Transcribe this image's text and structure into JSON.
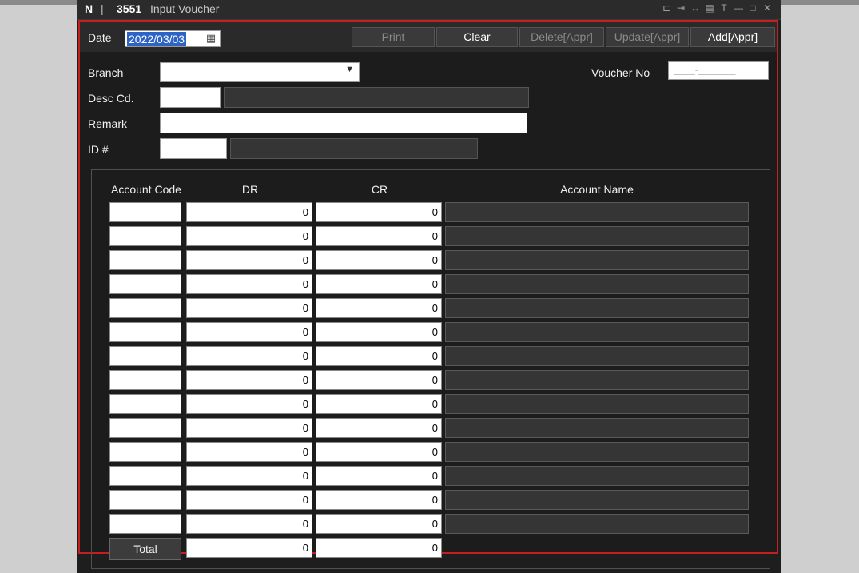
{
  "window": {
    "prefix": "N",
    "separator": "|",
    "screen_code": "3551",
    "screen_name": "Input Voucher",
    "icons": [
      "pin-icon",
      "export-icon",
      "link-icon",
      "copy-icon",
      "text-icon",
      "minimize-icon",
      "maximize-icon",
      "close-icon"
    ]
  },
  "toolbar": {
    "date_label": "Date",
    "date_value": "2022/03/03",
    "print_label": "Print",
    "clear_label": "Clear",
    "delete_label": "Delete[Appr]",
    "update_label": "Update[Appr]",
    "add_label": "Add[Appr]"
  },
  "form": {
    "branch_label": "Branch",
    "branch_value": "",
    "voucher_no_label": "Voucher No",
    "voucher_no_value": "____-_______",
    "desc_label": "Desc Cd.",
    "remark_label": "Remark",
    "id_label": "ID #"
  },
  "grid": {
    "headers": {
      "account_code": "Account Code",
      "dr": "DR",
      "cr": "CR",
      "account_name": "Account Name"
    },
    "rows": [
      {
        "code": "",
        "dr": "0",
        "cr": "0",
        "name": ""
      },
      {
        "code": "",
        "dr": "0",
        "cr": "0",
        "name": ""
      },
      {
        "code": "",
        "dr": "0",
        "cr": "0",
        "name": ""
      },
      {
        "code": "",
        "dr": "0",
        "cr": "0",
        "name": ""
      },
      {
        "code": "",
        "dr": "0",
        "cr": "0",
        "name": ""
      },
      {
        "code": "",
        "dr": "0",
        "cr": "0",
        "name": ""
      },
      {
        "code": "",
        "dr": "0",
        "cr": "0",
        "name": ""
      },
      {
        "code": "",
        "dr": "0",
        "cr": "0",
        "name": ""
      },
      {
        "code": "",
        "dr": "0",
        "cr": "0",
        "name": ""
      },
      {
        "code": "",
        "dr": "0",
        "cr": "0",
        "name": ""
      },
      {
        "code": "",
        "dr": "0",
        "cr": "0",
        "name": ""
      },
      {
        "code": "",
        "dr": "0",
        "cr": "0",
        "name": ""
      },
      {
        "code": "",
        "dr": "0",
        "cr": "0",
        "name": ""
      },
      {
        "code": "",
        "dr": "0",
        "cr": "0",
        "name": ""
      }
    ],
    "total_label": "Total",
    "total_dr": "0",
    "total_cr": "0"
  },
  "colors": {
    "frame_border": "#c41e1e",
    "selection": "#2c63c5",
    "background": "#1e1e1e"
  }
}
